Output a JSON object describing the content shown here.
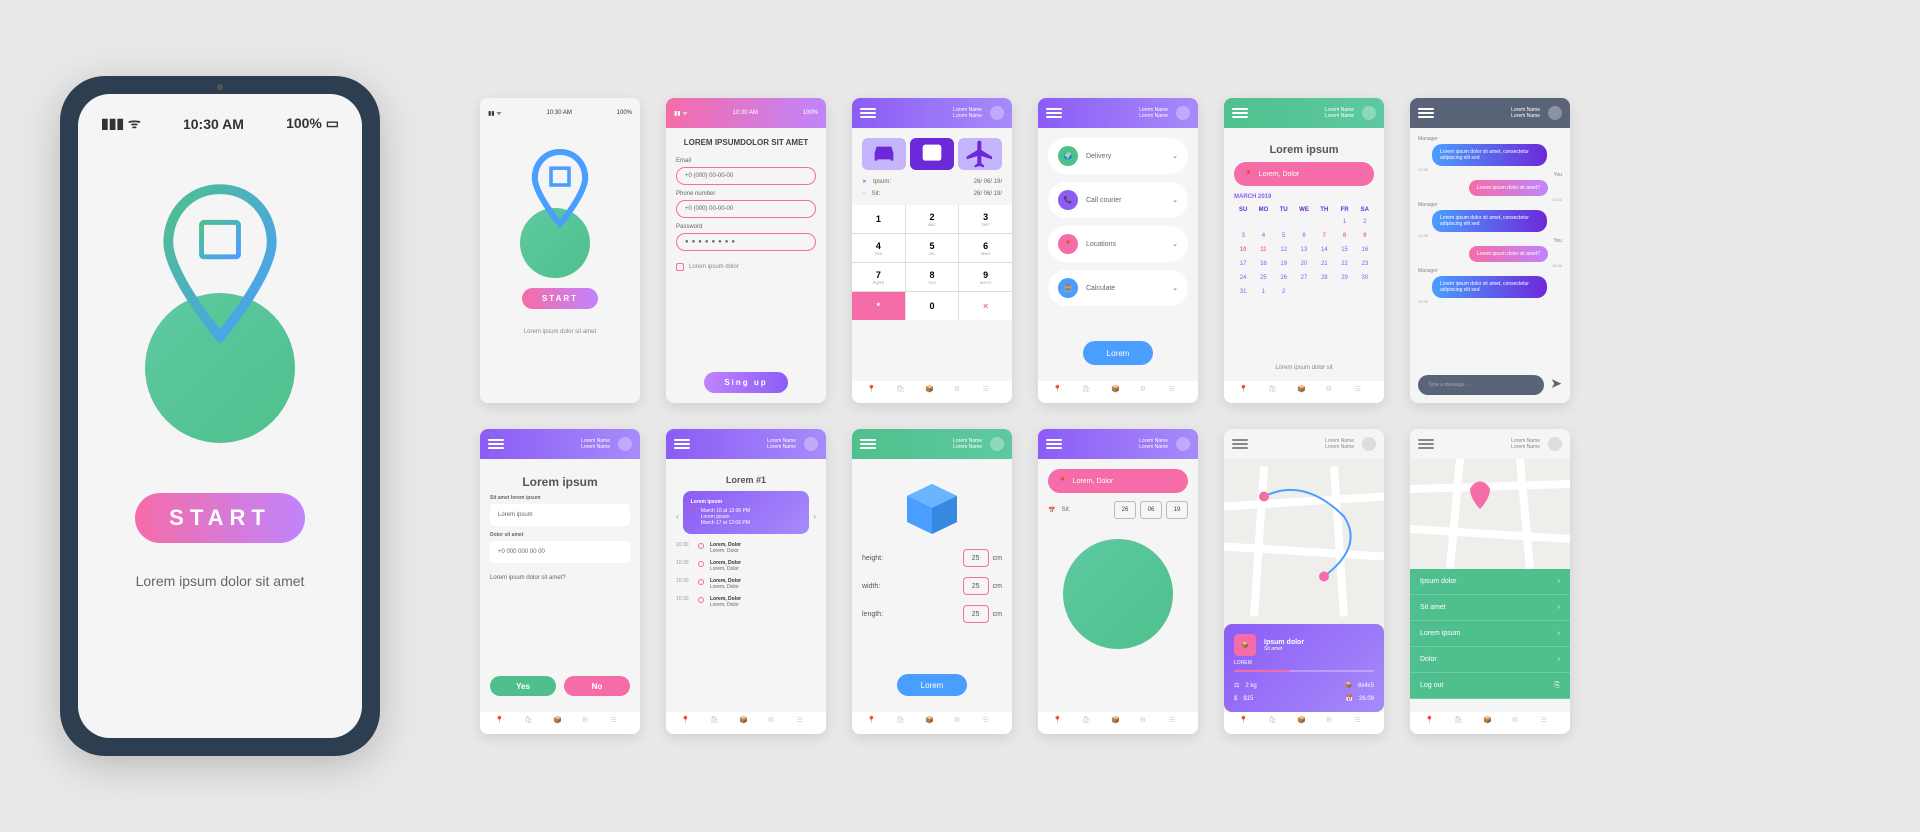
{
  "status": {
    "time": "10:30 AM",
    "battery": "100%"
  },
  "main": {
    "start": "START",
    "caption": "Lorem ipsum dolor sit amet"
  },
  "s1": {
    "start": "START",
    "caption": "Lorem ipsum dolor sit amet"
  },
  "s2": {
    "title": "LOREM IPSUMDOLOR SIT AMET",
    "email_lbl": "Email",
    "phone_lbl": "Phone number",
    "pwd_lbl": "Password",
    "placeholder": "+0 (000) 00-00-00",
    "check": "Lorem ipsum dolor",
    "signup": "Sing up"
  },
  "s3": {
    "user": "Lorem Name",
    "ipsum_lbl": "Ipsum:",
    "date": "26/ 06/ 19/",
    "sit_lbl": "Sit:",
    "sit_date": "26/ 06/ 19/",
    "keys": [
      "1",
      "2",
      "3",
      "4",
      "5",
      "6",
      "7",
      "8",
      "9",
      "*",
      "0",
      "×"
    ],
    "sub": [
      "",
      "ABC",
      "DEF",
      "GHI",
      "JKL",
      "MNO",
      "PQRS",
      "TUV",
      "WXYZ",
      "",
      "",
      ""
    ]
  },
  "s4": {
    "user": "Lorem Name",
    "opt1": "Delivery",
    "opt2": "Call courier",
    "opt3": "Locations",
    "opt4": "Calculate",
    "btn": "Lorem"
  },
  "s5": {
    "user": "Lorem Name",
    "title": "Lorem ipsum",
    "location": "Lorem, Dolor",
    "month": "MARCH 2019",
    "days": [
      "SU",
      "MO",
      "TU",
      "WE",
      "TH",
      "FR",
      "SA"
    ],
    "caption": "Lorem ipsum dolor sit"
  },
  "s6": {
    "user": "Lorem Name",
    "mgr": "Manager",
    "you": "You",
    "time": "10:30",
    "msg1": "Lorem ipsum dolor sit amet, consectetur adipiscing elit sed",
    "msg2": "Lorem ipsum dolor sit amet?",
    "type": "Type a message ..."
  },
  "s7": {
    "user": "Lorem Name",
    "title": "Lorem ipsum",
    "lbl1": "Sit amet lorem ipsum",
    "val1": "Lorem ipsum",
    "lbl2": "Dolor sit amet",
    "val2": "+0 000 000 00 00",
    "q": "Lorem ipsum dolor sit amet?",
    "yes": "Yes",
    "no": "No"
  },
  "s8": {
    "user": "Lorem Name",
    "title": "Lorem #1",
    "card_t": "Lorem ipsum",
    "card_d1": "March 16 at 12:06 PM",
    "card_d2": "Lorem ipsum",
    "card_d3": "March 17 at 12:06 PM",
    "track": "Lorem, Dolor",
    "track_sub": "Lorem, Dolor"
  },
  "s9": {
    "user": "Lorem Name",
    "h": "height:",
    "w": "width:",
    "l": "length:",
    "val": "25",
    "cm": "cm",
    "btn": "Lorem"
  },
  "s10": {
    "user": "Lorem Name",
    "location": "Lorem, Dolor",
    "sit": "Sit:",
    "d1": "26",
    "d2": "06",
    "d3": "19"
  },
  "s11": {
    "user": "Lorem Name",
    "card_t": "Ipsum dolor",
    "card_s": "Sit amet",
    "lorem": "LOREM",
    "weight": "2 kg",
    "dims": "8x4x5",
    "price": "$15",
    "dist": "26.09"
  },
  "s12": {
    "user": "Lorem Name",
    "m1": "Ipsum dolor",
    "m2": "Sit amet",
    "m3": "Lorem ipsum",
    "m4": "Dolor",
    "m5": "Log out"
  }
}
